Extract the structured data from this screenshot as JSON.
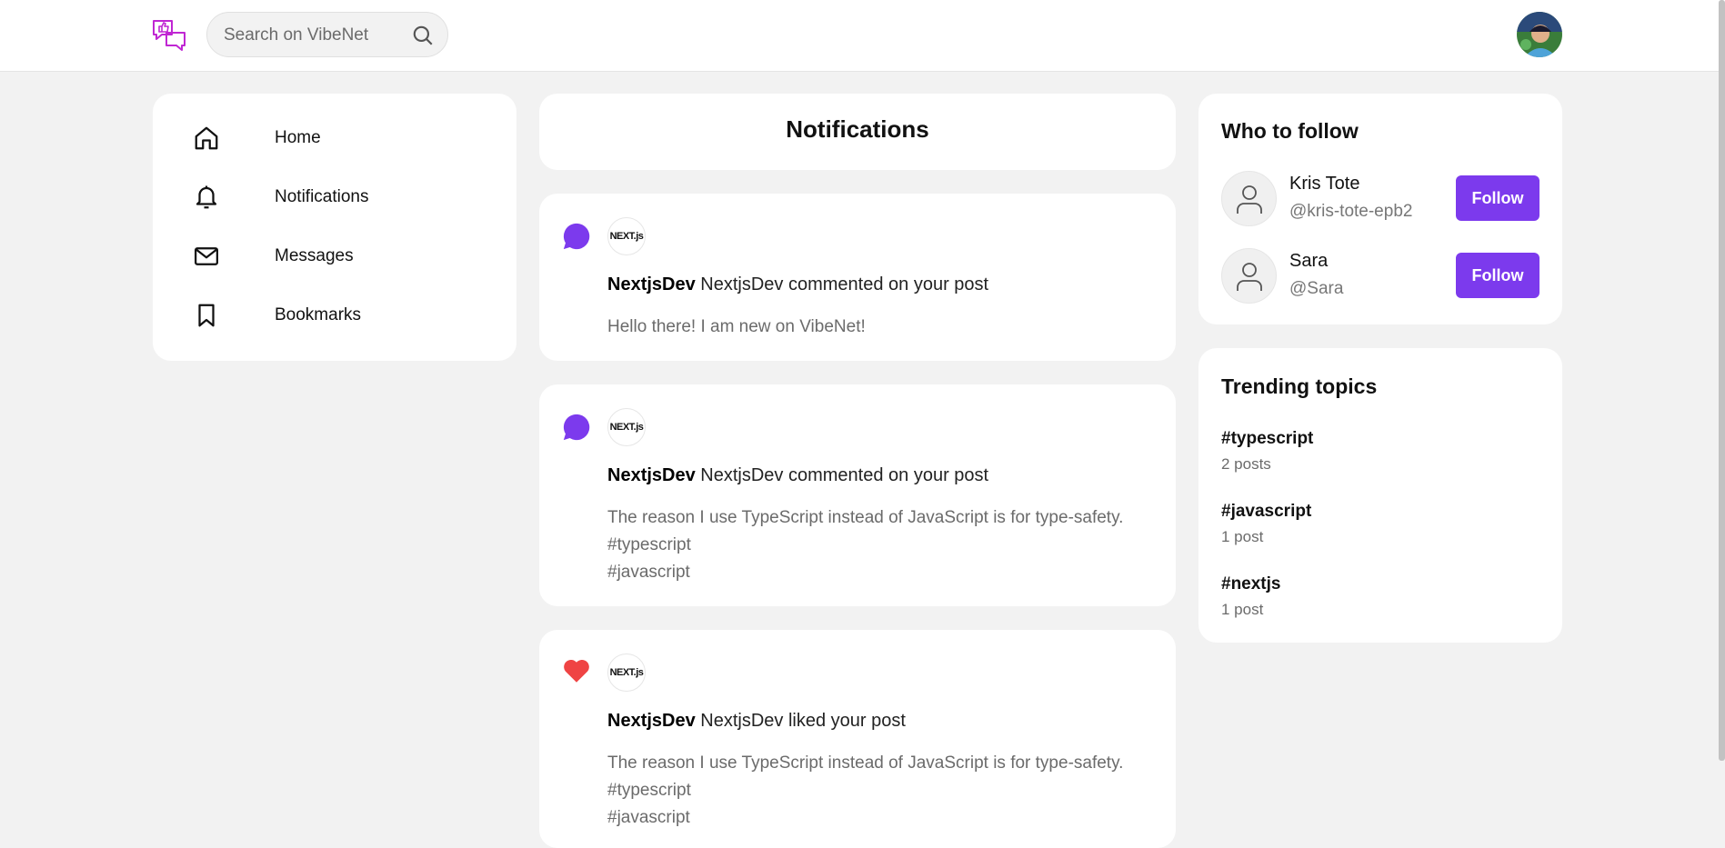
{
  "header": {
    "logo_icon": "chat-bubbles-thumbs-up-icon",
    "search_placeholder": "Search on VibeNet",
    "search_icon": "search-icon",
    "avatar": "user-avatar"
  },
  "sidebar": {
    "items": [
      {
        "label": "Home",
        "icon": "home-icon"
      },
      {
        "label": "Notifications",
        "icon": "bell-icon"
      },
      {
        "label": "Messages",
        "icon": "mail-icon"
      },
      {
        "label": "Bookmarks",
        "icon": "bookmark-icon"
      }
    ]
  },
  "main": {
    "title": "Notifications",
    "notifications": [
      {
        "type": "comment",
        "user": "NextjsDev",
        "action": "NextjsDev commented on your post",
        "content": "Hello there! I am new on VibeNet!",
        "logo_text": "NEXT.js"
      },
      {
        "type": "comment",
        "user": "NextjsDev",
        "action": "NextjsDev commented on your post",
        "content": "The reason I use TypeScript instead of JavaScript is for type-safety.\n#typescript\n#javascript",
        "logo_text": "NEXT.js"
      },
      {
        "type": "like",
        "user": "NextjsDev",
        "action": "NextjsDev liked your post",
        "content": "The reason I use TypeScript instead of JavaScript is for type-safety.\n#typescript\n#javascript",
        "logo_text": "NEXT.js"
      }
    ]
  },
  "who_to_follow": {
    "title": "Who to follow",
    "users": [
      {
        "name": "Kris Tote",
        "handle": "@kris-tote-epb2",
        "button": "Follow"
      },
      {
        "name": "Sara",
        "handle": "@Sara",
        "button": "Follow"
      }
    ]
  },
  "trending": {
    "title": "Trending topics",
    "topics": [
      {
        "tag": "#typescript",
        "count": "2 posts"
      },
      {
        "tag": "#javascript",
        "count": "1 post"
      },
      {
        "tag": "#nextjs",
        "count": "1 post"
      }
    ]
  },
  "colors": {
    "accent": "#7c3aed",
    "like": "#ef4444",
    "background": "#f2f2f2",
    "logo": "#c026d3"
  }
}
